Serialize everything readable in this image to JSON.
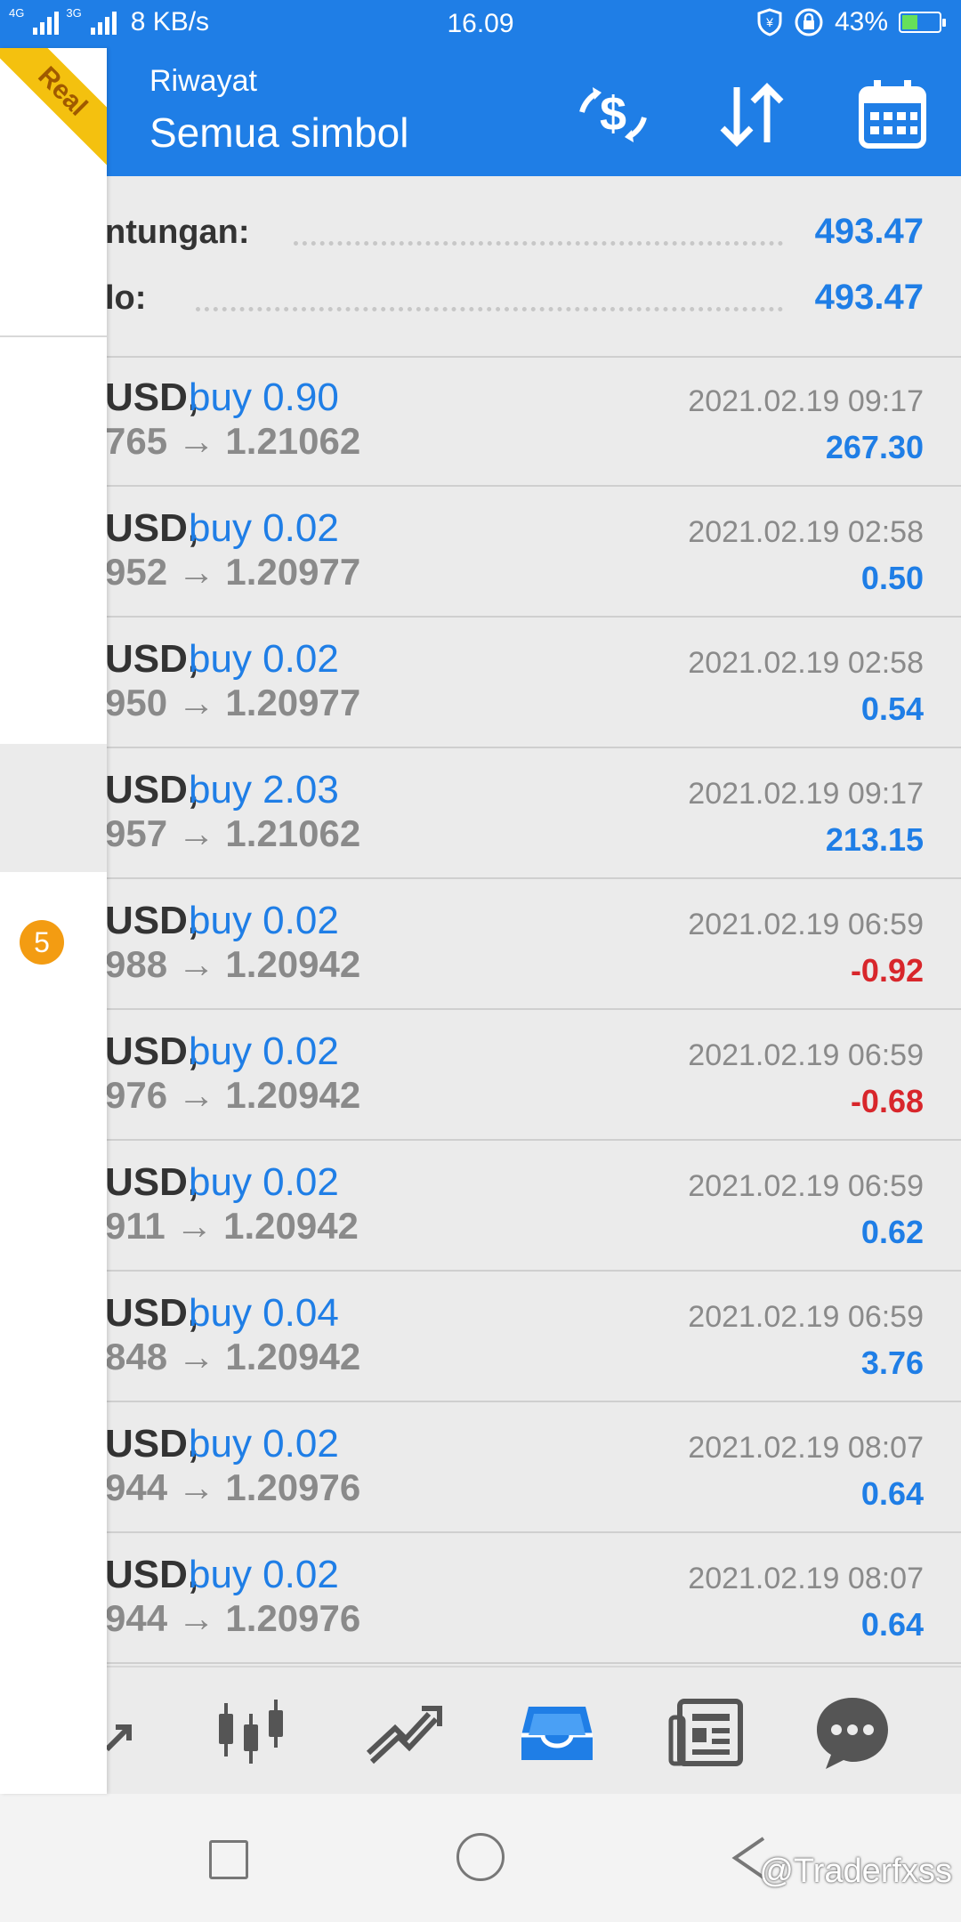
{
  "status": {
    "net_labels": [
      "4G",
      "3G"
    ],
    "speed": "8 KB/s",
    "time": "16.09",
    "battery": "43%",
    "battery_level": 0.43
  },
  "toolbar": {
    "subtitle": "Riwayat",
    "title": "Semua simbol",
    "icons": [
      "currency-exchange-icon",
      "sort-icon",
      "calendar-icon"
    ]
  },
  "summary": [
    {
      "label": "ntungan:",
      "value": "493.47"
    },
    {
      "label": "lo:",
      "value": "493.47"
    }
  ],
  "deals": [
    {
      "symbol": "USD,",
      "side": "buy 0.90",
      "prices": "765 → 1.21062",
      "time": "2021.02.19 09:17",
      "profit": "267.30",
      "profit_sign": "pos"
    },
    {
      "symbol": "USD,",
      "side": "buy 0.02",
      "prices": "952 → 1.20977",
      "time": "2021.02.19 02:58",
      "profit": "0.50",
      "profit_sign": "pos"
    },
    {
      "symbol": "USD,",
      "side": "buy 0.02",
      "prices": "950 → 1.20977",
      "time": "2021.02.19 02:58",
      "profit": "0.54",
      "profit_sign": "pos"
    },
    {
      "symbol": "USD,",
      "side": "buy 2.03",
      "prices": "957 → 1.21062",
      "time": "2021.02.19 09:17",
      "profit": "213.15",
      "profit_sign": "pos"
    },
    {
      "symbol": "USD,",
      "side": "buy 0.02",
      "prices": "988 → 1.20942",
      "time": "2021.02.19 06:59",
      "profit": "-0.92",
      "profit_sign": "neg"
    },
    {
      "symbol": "USD,",
      "side": "buy 0.02",
      "prices": "976 → 1.20942",
      "time": "2021.02.19 06:59",
      "profit": "-0.68",
      "profit_sign": "neg"
    },
    {
      "symbol": "USD,",
      "side": "buy 0.02",
      "prices": "911 → 1.20942",
      "time": "2021.02.19 06:59",
      "profit": "0.62",
      "profit_sign": "pos"
    },
    {
      "symbol": "USD,",
      "side": "buy 0.04",
      "prices": "848 → 1.20942",
      "time": "2021.02.19 06:59",
      "profit": "3.76",
      "profit_sign": "pos"
    },
    {
      "symbol": "USD,",
      "side": "buy 0.02",
      "prices": "944 → 1.20976",
      "time": "2021.02.19 08:07",
      "profit": "0.64",
      "profit_sign": "pos"
    },
    {
      "symbol": "USD,",
      "side": "buy 0.02",
      "prices": "944 → 1.20976",
      "time": "2021.02.19 08:07",
      "profit": "0.64",
      "profit_sign": "pos"
    }
  ],
  "bottom_nav": [
    "trade-icon",
    "chart-candles-icon",
    "trend-icon",
    "history-inbox-icon",
    "news-icon",
    "chat-icon"
  ],
  "drawer": {
    "ribbon": "Real",
    "badge": "5"
  },
  "watermark": "@Traderfxss",
  "colors": {
    "accent": "#1f7ee6",
    "negative": "#d8262b",
    "ribbon": "#f4c10f",
    "badge": "#f39c12"
  }
}
